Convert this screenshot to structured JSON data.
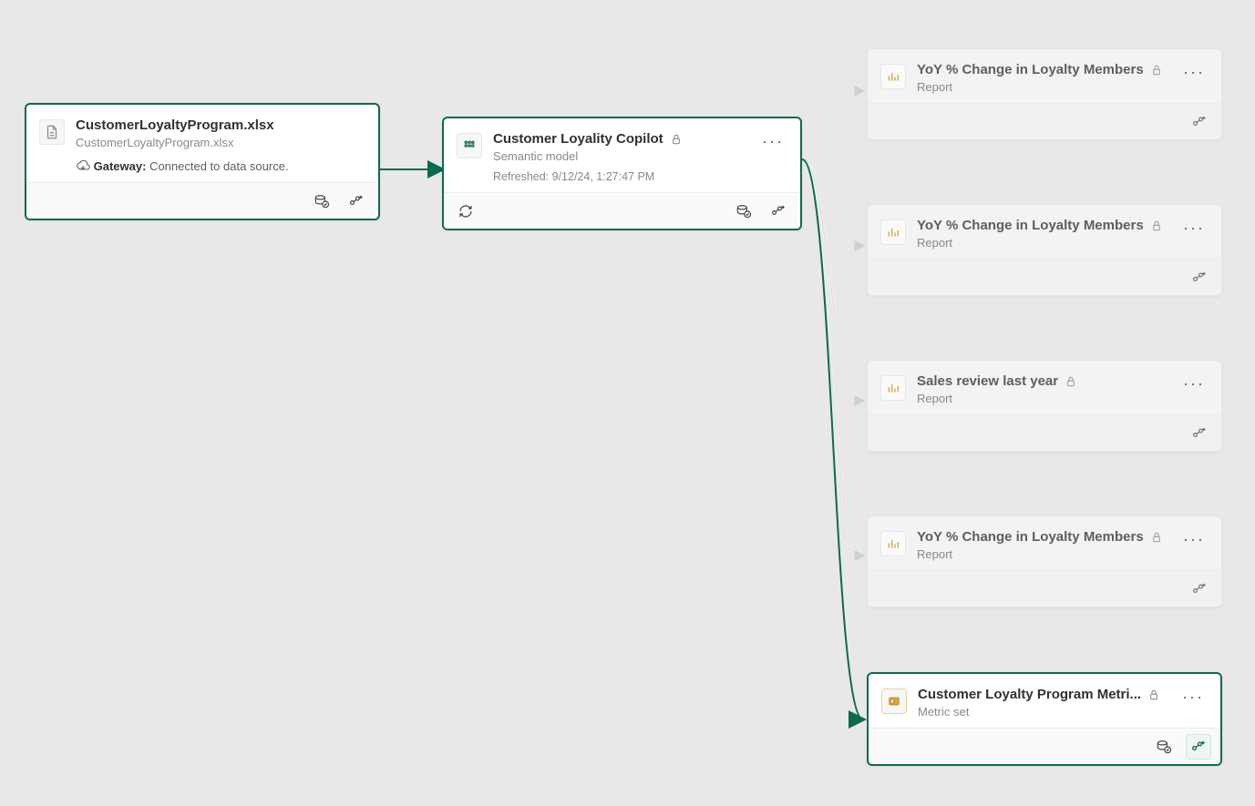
{
  "source": {
    "title": "CustomerLoyaltyProgram.xlsx",
    "subtitle": "CustomerLoyaltyProgram.xlsx",
    "gateway_label": "Gateway:",
    "gateway_status": "Connected to data source."
  },
  "model": {
    "title": "Customer Loyality Copilot",
    "subtitle": "Semantic model",
    "refreshed": "Refreshed: 9/12/24, 1:27:47 PM"
  },
  "outputs": [
    {
      "title": "YoY % Change in Loyalty Members",
      "subtitle": "Report",
      "type": "report",
      "active": false
    },
    {
      "title": "YoY % Change in Loyalty Members",
      "subtitle": "Report",
      "type": "report",
      "active": false
    },
    {
      "title": "Sales review last year",
      "subtitle": "Report",
      "type": "report",
      "active": false
    },
    {
      "title": "YoY % Change in Loyalty Members",
      "subtitle": "Report",
      "type": "report",
      "active": false
    },
    {
      "title": "Customer Loyalty Program Metri...",
      "subtitle": "Metric set",
      "type": "metricset",
      "active": true
    }
  ],
  "colors": {
    "accent": "#0b6a4f",
    "faded_line": "#d4d4d4"
  }
}
